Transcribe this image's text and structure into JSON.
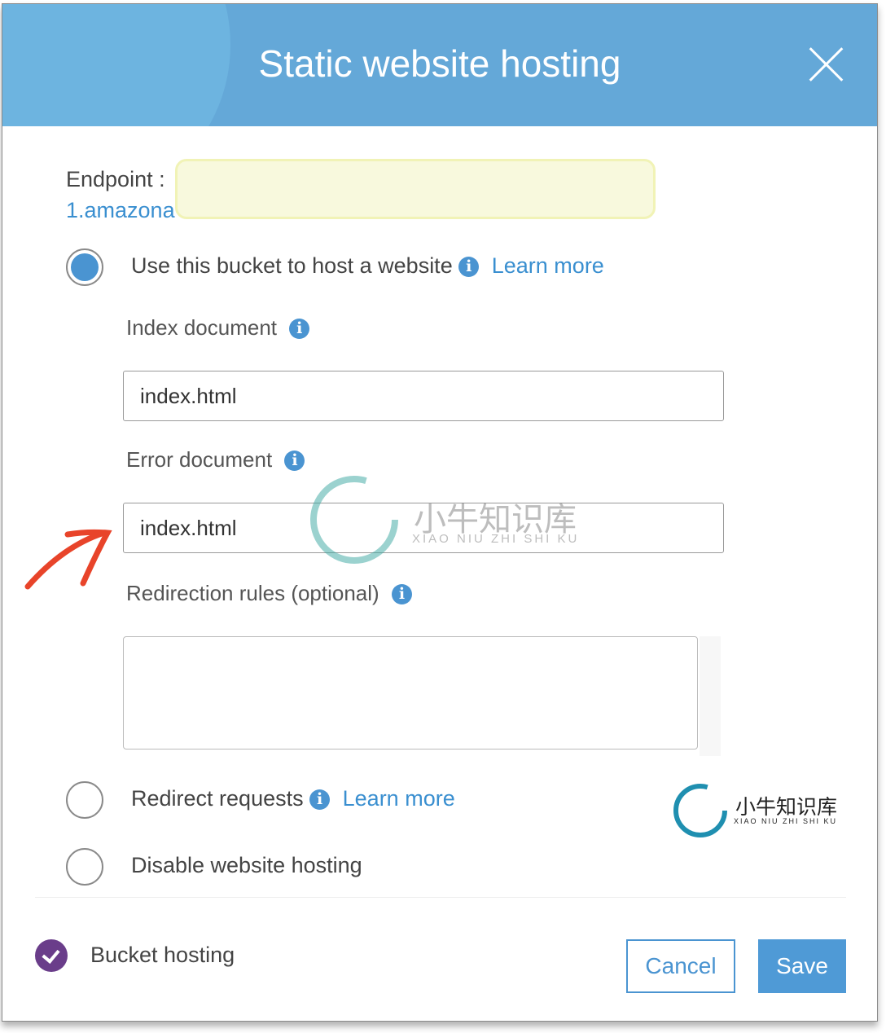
{
  "dialog": {
    "title": "Static website hosting",
    "close_icon": "close-icon"
  },
  "endpoint": {
    "label": "Endpoint :",
    "value_visible": "1.amazona"
  },
  "options": [
    {
      "label": "Use this bucket to host a website",
      "selected": true,
      "learn_more": "Learn more"
    },
    {
      "label": "Redirect requests",
      "selected": false,
      "learn_more": "Learn more"
    },
    {
      "label": "Disable website hosting",
      "selected": false
    }
  ],
  "form": {
    "index_label": "Index document",
    "index_value": "index.html",
    "error_label": "Error document",
    "error_value": "index.html",
    "redirection_label": "Redirection rules (optional)",
    "redirection_value": ""
  },
  "footer": {
    "status_label": "Bucket hosting",
    "cancel": "Cancel",
    "save": "Save"
  },
  "watermark": {
    "cn": "小牛知识库",
    "pinyin": "XIAO NIU ZHI SHI KU"
  },
  "colors": {
    "header": "#64a8d8",
    "accent": "#4a94d1",
    "check": "#6a3d8a",
    "annotation_arrow": "#e8442a"
  }
}
